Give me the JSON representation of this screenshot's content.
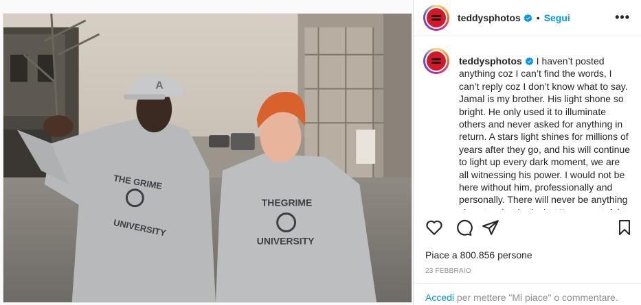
{
  "header": {
    "username": "teddysphotos",
    "separator": "•",
    "follow_label": "Segui",
    "more_label": "•••"
  },
  "caption": {
    "username": "teddysphotos",
    "text": "I haven’t posted anything coz I can’t find the words, I can’t reply coz I don’t know what to say. Jamal is my brother. His light shone so bright. He only used it to illuminate others and never asked for anything in return. A stars light shines for millions of years after they go, and his will continue to light up every dark moment, we are all witnessing his power. I would not be here without him, professionally and personally. There will never be anything close to what he is, but I'm so grateful to"
  },
  "post": {
    "likes": "Piace a 800.856 persone",
    "date": "23 FEBBRAIO"
  },
  "comment_bar": {
    "login_link": "Accedi",
    "rest": " per mettere \"Mi piace\" o commentare."
  },
  "colors": {
    "link_blue": "#0095f6",
    "avatar_red": "#d7162a",
    "muted": "#8e8e8e"
  },
  "icons": [
    "heart-icon",
    "comment-icon",
    "share-icon",
    "bookmark-icon",
    "verified-icon",
    "more-icon"
  ]
}
